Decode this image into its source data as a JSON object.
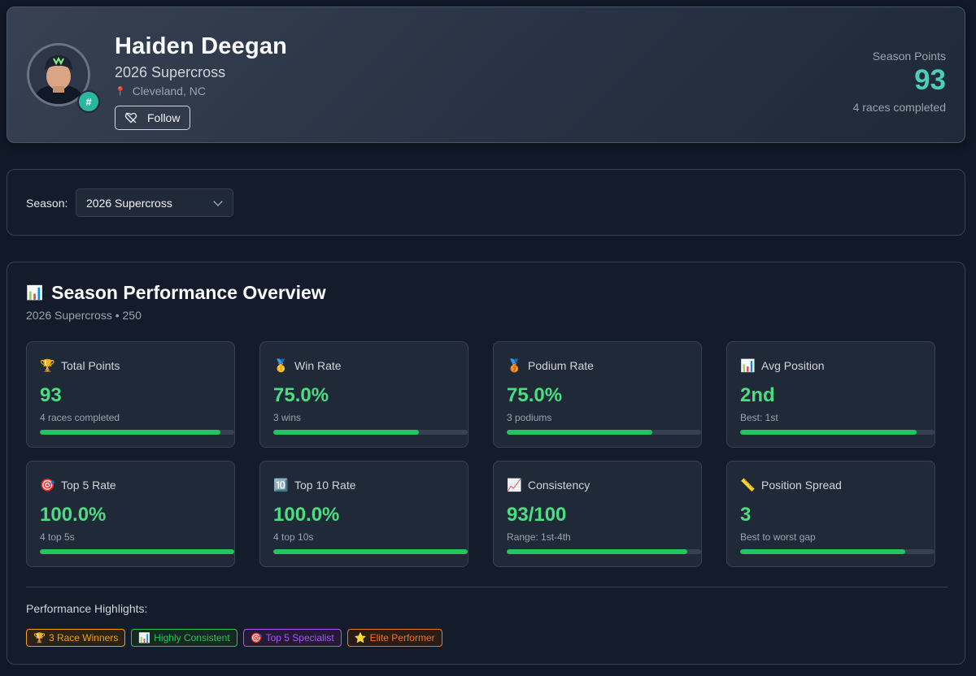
{
  "rider": {
    "name": "Haiden Deegan",
    "series": "2026 Supercross",
    "location": "Cleveland, NC",
    "number_badge": "#",
    "follow_label": "Follow"
  },
  "season_summary": {
    "label": "Season Points",
    "value": "93",
    "sub": "4 races completed"
  },
  "season_selector": {
    "label": "Season:",
    "selected": "2026 Supercross"
  },
  "overview": {
    "title": "Season Performance Overview",
    "subtitle": "2026 Supercross • 250",
    "stats": [
      {
        "icon": "🏆",
        "icon_name": "trophy-icon",
        "label": "Total Points",
        "value": "93",
        "sub": "4 races completed",
        "fill": 0.93
      },
      {
        "icon": "🥇",
        "icon_name": "gold-medal-icon",
        "label": "Win Rate",
        "value": "75.0%",
        "sub": "3 wins",
        "fill": 0.75
      },
      {
        "icon": "🥉",
        "icon_name": "bronze-medal-icon",
        "label": "Podium Rate",
        "value": "75.0%",
        "sub": "3 podiums",
        "fill": 0.75
      },
      {
        "icon": "📊",
        "icon_name": "bar-chart-icon",
        "label": "Avg Position",
        "value": "2nd",
        "sub": "Best: 1st",
        "fill": 0.91
      },
      {
        "icon": "🎯",
        "icon_name": "target-icon",
        "label": "Top 5 Rate",
        "value": "100.0%",
        "sub": "4 top 5s",
        "fill": 1.0
      },
      {
        "icon": "🔟",
        "icon_name": "ten-icon",
        "label": "Top 10 Rate",
        "value": "100.0%",
        "sub": "4 top 10s",
        "fill": 1.0
      },
      {
        "icon": "📈",
        "icon_name": "trending-up-icon",
        "label": "Consistency",
        "value": "93/100",
        "sub": "Range: 1st-4th",
        "fill": 0.93
      },
      {
        "icon": "📏",
        "icon_name": "ruler-icon",
        "label": "Position Spread",
        "value": "3",
        "sub": "Best to worst gap",
        "fill": 0.85
      }
    ]
  },
  "highlights": {
    "title": "Performance Highlights:",
    "badges": [
      {
        "icon": "🏆",
        "label": "3 Race Winners",
        "color": "#f59e0b",
        "bg": "#2a2316"
      },
      {
        "icon": "📊",
        "label": "Highly Consistent",
        "color": "#22c55e",
        "bg": "#16281f"
      },
      {
        "icon": "🎯",
        "label": "Top 5 Specialist",
        "color": "#a855f7",
        "bg": "#231a36"
      },
      {
        "icon": "⭐",
        "label": "Elite Performer",
        "color": "#f97316",
        "bg": "#2a1c17"
      }
    ]
  },
  "colors": {
    "accent_teal": "#4ecdb3",
    "stat_green": "#4ade80",
    "bar_green": "#22c55e",
    "background": "#111827"
  }
}
